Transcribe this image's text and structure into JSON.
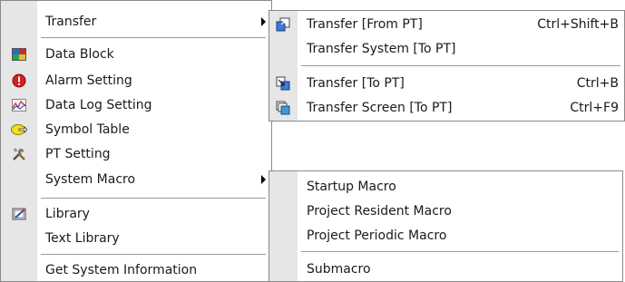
{
  "main_menu": {
    "items": [
      {
        "label": "Transfer"
      },
      {
        "label": "Data Block"
      },
      {
        "label": "Alarm Setting"
      },
      {
        "label": "Data Log Setting"
      },
      {
        "label": "Symbol Table"
      },
      {
        "label": "PT Setting"
      },
      {
        "label": "System Macro"
      },
      {
        "label": "Library"
      },
      {
        "label": "Text Library"
      },
      {
        "label": "Get System Information"
      }
    ]
  },
  "transfer_submenu": {
    "items": [
      {
        "label": "Transfer [From PT]",
        "shortcut": "Ctrl+Shift+B"
      },
      {
        "label": "Transfer System [To PT]",
        "shortcut": ""
      },
      {
        "label": "Transfer [To PT]",
        "shortcut": "Ctrl+B"
      },
      {
        "label": "Transfer Screen [To PT]",
        "shortcut": "Ctrl+F9"
      }
    ]
  },
  "macro_submenu": {
    "items": [
      {
        "label": "Startup Macro"
      },
      {
        "label": "Project Resident Macro"
      },
      {
        "label": "Project Periodic Macro"
      },
      {
        "label": "Submacro"
      }
    ]
  },
  "icons": {
    "data_block": "data-block-icon",
    "alarm": "alarm-icon",
    "data_log": "data-log-icon",
    "symbol_table": "symbol-table-icon",
    "pt_setting": "tools-icon",
    "library": "library-icon",
    "transfer_from_pt": "transfer-from-pt-icon",
    "transfer_to_pt": "transfer-to-pt-icon",
    "transfer_screen": "transfer-screen-icon"
  },
  "colors": {
    "menu_bg": "#ffffff",
    "gutter_bg": "#e6e6e6",
    "separator": "#9a9a9a",
    "border": "#8a8a8a",
    "text": "#1a1a1a"
  }
}
